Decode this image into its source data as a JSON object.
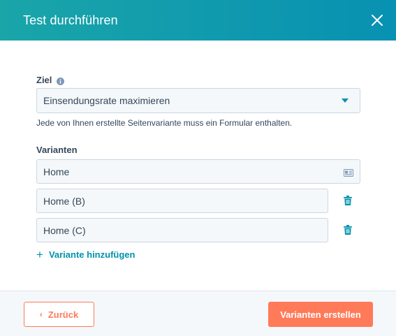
{
  "dialog": {
    "title": "Test durchführen",
    "close_icon": "close-icon"
  },
  "goal": {
    "label": "Ziel",
    "info_icon": "info-icon",
    "selected": "Einsendungsrate maximieren",
    "help_text": "Jede von Ihnen erstellte Seitenvariante muss ein Formular enthalten."
  },
  "variants": {
    "label": "Varianten",
    "items": [
      {
        "name": "Home",
        "icon": "card-icon"
      },
      {
        "name": "Home (B)",
        "icon": "trash-icon"
      },
      {
        "name": "Home (C)",
        "icon": "trash-icon"
      }
    ],
    "add_label": "Variante hinzufügen"
  },
  "footer": {
    "back_label": "Zurück",
    "create_label": "Varianten erstellen"
  },
  "colors": {
    "header_start": "#1aa5a9",
    "header_end": "#0891b2",
    "accent": "#0091ae",
    "primary": "#ff7a59"
  }
}
